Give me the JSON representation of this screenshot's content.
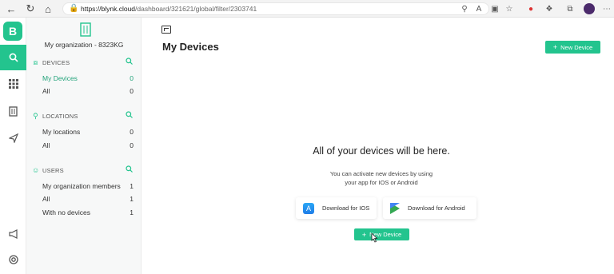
{
  "browser": {
    "url_host": "https://blynk.cloud",
    "url_path": "/dashboard/321621/global/filter/2303741"
  },
  "rail": {
    "logo": "B",
    "items": [
      {
        "name": "search-icon",
        "active": true
      },
      {
        "name": "apps-grid-icon",
        "active": false
      },
      {
        "name": "building-icon",
        "active": false
      },
      {
        "name": "send-icon",
        "active": false
      },
      {
        "name": "megaphone-icon",
        "active": false
      },
      {
        "name": "help-ring-icon",
        "active": false
      }
    ]
  },
  "sidebar": {
    "org_name": "My organization - 8323KG",
    "devices": {
      "title": "DEVICES",
      "items": [
        {
          "label": "My Devices",
          "count": "0"
        },
        {
          "label": "All",
          "count": "0"
        }
      ]
    },
    "locations": {
      "title": "LOCATIONS",
      "items": [
        {
          "label": "My locations",
          "count": "0"
        },
        {
          "label": "All",
          "count": "0"
        }
      ]
    },
    "users": {
      "title": "USERS",
      "items": [
        {
          "label": "My organization members",
          "count": "1"
        },
        {
          "label": "All",
          "count": "1"
        },
        {
          "label": "With no devices",
          "count": "1"
        }
      ]
    }
  },
  "main": {
    "title": "My Devices",
    "new_device_label": "New Device",
    "empty_title": "All of your devices will be here.",
    "empty_desc_line1": "You can activate new devices by using",
    "empty_desc_line2": "your app for IOS or Android",
    "ios_label": "Download for IOS",
    "android_label": "Download for Android",
    "center_button_label": "New Device"
  },
  "colors": {
    "accent": "#23c48e"
  }
}
